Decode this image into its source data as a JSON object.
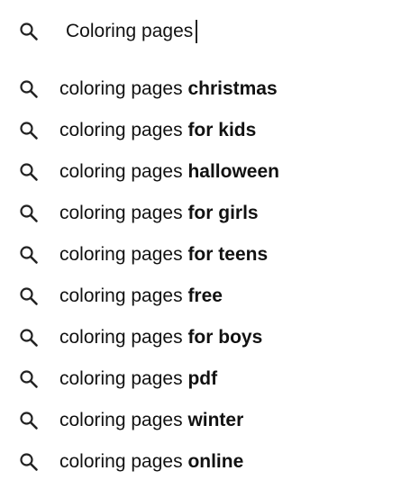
{
  "search": {
    "value": "Coloring pages",
    "icon": "search-icon"
  },
  "suggestions": [
    {
      "prefix": "coloring pages ",
      "completion": "christmas",
      "icon": "search-icon"
    },
    {
      "prefix": "coloring pages ",
      "completion": "for kids",
      "icon": "search-icon"
    },
    {
      "prefix": "coloring pages ",
      "completion": "halloween",
      "icon": "search-icon"
    },
    {
      "prefix": "coloring pages ",
      "completion": "for girls",
      "icon": "search-icon"
    },
    {
      "prefix": "coloring pages ",
      "completion": "for teens",
      "icon": "search-icon"
    },
    {
      "prefix": "coloring pages ",
      "completion": "free",
      "icon": "search-icon"
    },
    {
      "prefix": "coloring pages ",
      "completion": "for boys",
      "icon": "search-icon"
    },
    {
      "prefix": "coloring pages ",
      "completion": "pdf",
      "icon": "search-icon"
    },
    {
      "prefix": "coloring pages ",
      "completion": "winter",
      "icon": "search-icon"
    },
    {
      "prefix": "coloring pages ",
      "completion": "online",
      "icon": "search-icon"
    }
  ],
  "colors": {
    "text": "#111111",
    "icon": "#222222",
    "background": "#ffffff"
  }
}
